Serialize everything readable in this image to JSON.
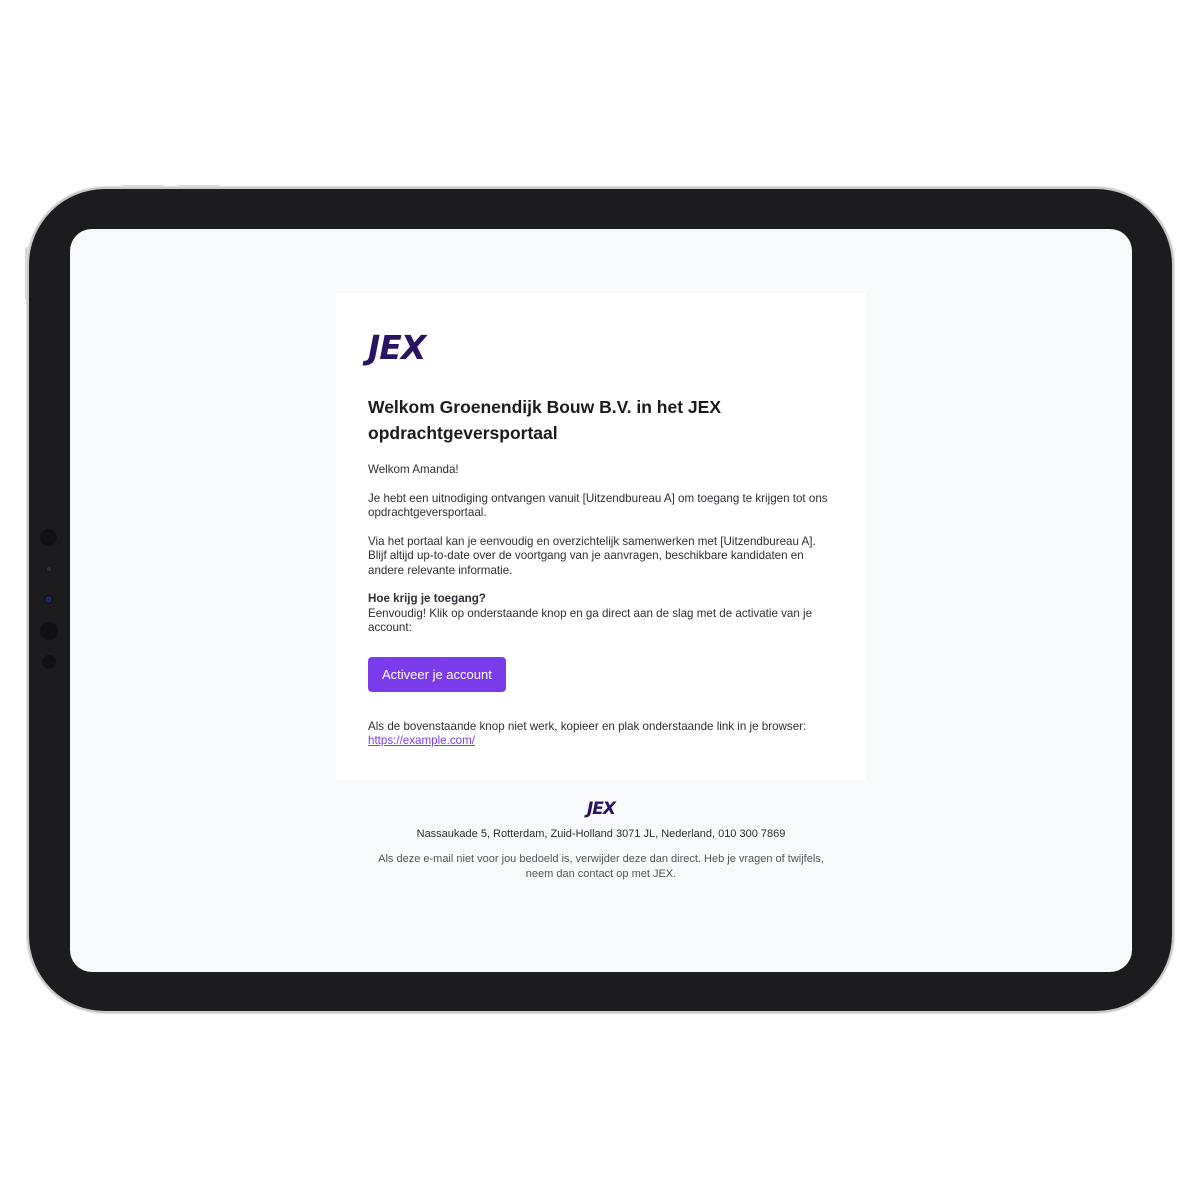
{
  "brand": {
    "logo_text": "JEX",
    "logo_color": "#2a1462",
    "accent_color": "#7a3bea"
  },
  "email": {
    "title": "Welkom Groenendijk Bouw B.V. in het JEX opdrachtgeversportaal",
    "greeting": "Welkom Amanda!",
    "paragraph_invite": "Je hebt een uitnodiging ontvangen vanuit [Uitzendbureau A] om toegang te krijgen tot ons opdrachtgeversportaal.",
    "paragraph_portal": "Via het portaal kan je eenvoudig en overzichtelijk samenwerken met [Uitzendbureau A]. Blijf altijd up-to-date over de voortgang van je aanvragen, beschikbare kandidaten en andere relevante informatie.",
    "access_heading": "Hoe krijg je toegang?",
    "access_text": "Eenvoudig! Klik op onderstaande knop en ga direct aan de slag met de activatie van je account:",
    "cta_label": "Activeer je account",
    "fallback_text": "Als de bovenstaande knop niet werk, kopieer en plak onderstaande link in je browser:",
    "fallback_link": "https://example.com/"
  },
  "footer": {
    "logo_text": "JEX",
    "address": "Nassaukade 5, Rotterdam, Zuid-Holland 3071 JL, Nederland, 010 300 7869",
    "disclaimer": "Als deze e-mail niet voor jou bedoeld is, verwijder deze dan direct. Heb je vragen of twijfels, neem dan contact op met JEX."
  }
}
